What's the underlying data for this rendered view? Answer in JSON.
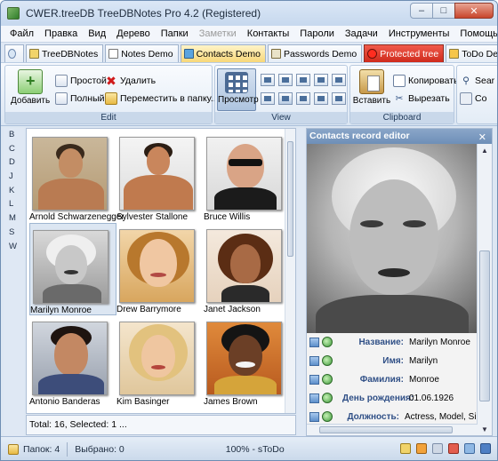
{
  "window": {
    "title": "CWER.treeDB TreeDBNotes Pro 4.2 (Registered)",
    "min_glyph": "–",
    "max_glyph": "□",
    "close_glyph": "✕"
  },
  "menu": [
    {
      "label": "Файл",
      "enabled": true
    },
    {
      "label": "Правка",
      "enabled": true
    },
    {
      "label": "Вид",
      "enabled": true
    },
    {
      "label": "Дерево",
      "enabled": true
    },
    {
      "label": "Папки",
      "enabled": true
    },
    {
      "label": "Заметки",
      "enabled": false
    },
    {
      "label": "Контакты",
      "enabled": true
    },
    {
      "label": "Пароли",
      "enabled": true
    },
    {
      "label": "Задачи",
      "enabled": true
    },
    {
      "label": "Инструменты",
      "enabled": true
    },
    {
      "label": "Помощь",
      "enabled": true
    }
  ],
  "tabs": [
    {
      "label": "TreeDBNotes"
    },
    {
      "label": "Notes Demo"
    },
    {
      "label": "Contacts Demo"
    },
    {
      "label": "Passwords Demo"
    },
    {
      "label": "Protected tree"
    },
    {
      "label": "ToDo Dem"
    }
  ],
  "ribbon": {
    "edit": {
      "label": "Edit",
      "add": "Добавить",
      "simple": "Простой",
      "full": "Полный",
      "delete": "Удалить",
      "move": "Переместить в папку..."
    },
    "view": {
      "label": "View",
      "preview": "Просмотр"
    },
    "clipboard": {
      "label": "Clipboard",
      "paste": "Вставить",
      "copy": "Копировать",
      "cut": "Вырезать"
    },
    "search": {
      "label1": "Sear",
      "label2": "Co"
    }
  },
  "alphabet": [
    "B",
    "C",
    "D",
    "J",
    "K",
    "L",
    "M",
    "S",
    "W"
  ],
  "contacts": [
    {
      "name": "Arnold Schwarzenegger",
      "selected": false
    },
    {
      "name": "Sylvester Stallone",
      "selected": false
    },
    {
      "name": "Bruce Willis",
      "selected": false
    },
    {
      "name": "Marilyn Monroe",
      "selected": true
    },
    {
      "name": "Drew Barrymore",
      "selected": false
    },
    {
      "name": "Janet Jackson",
      "selected": false
    },
    {
      "name": "Antonio Banderas",
      "selected": false
    },
    {
      "name": "Kim Basinger",
      "selected": false
    },
    {
      "name": "James Brown",
      "selected": false
    }
  ],
  "list_footer": "Total: 16, Selected: 1 ...",
  "editor": {
    "title": "Contacts record editor",
    "fields": [
      {
        "label": "Название:",
        "value": "Marilyn Monroe"
      },
      {
        "label": "Имя:",
        "value": "Marilyn"
      },
      {
        "label": "Фамилия:",
        "value": "Monroe"
      },
      {
        "label": "День рождения:",
        "value": "01.06.1926"
      },
      {
        "label": "Должность:",
        "value": "Actress, Model, Sin"
      }
    ]
  },
  "status": {
    "folders": "Папок: 4",
    "selected": "Выбрано: 0",
    "zoom": "100% - sToDo"
  }
}
